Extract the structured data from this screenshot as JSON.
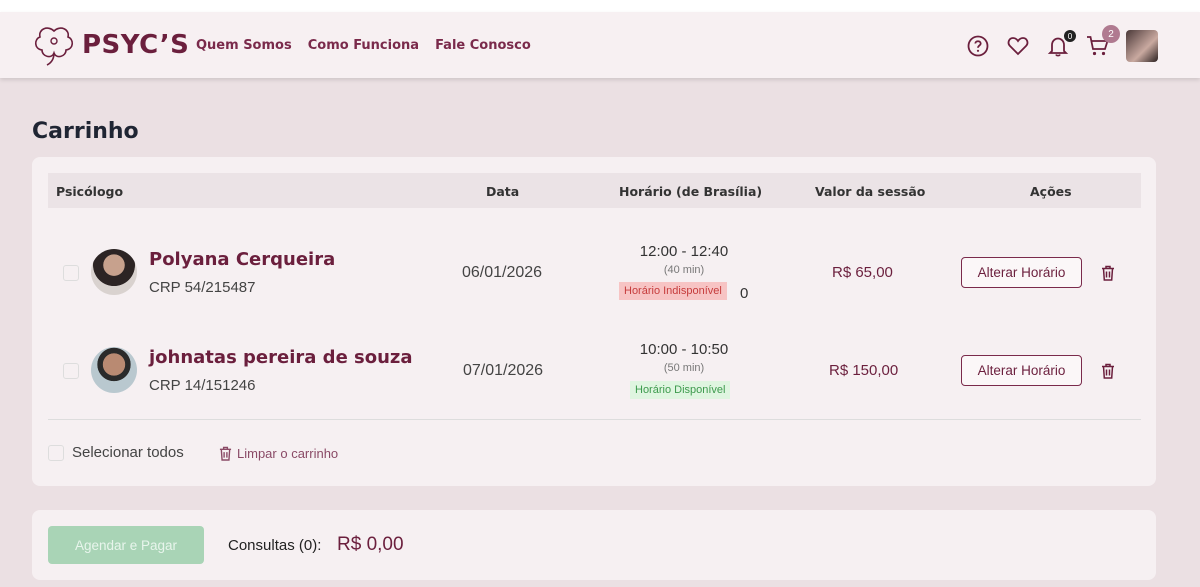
{
  "brand": {
    "name": "PSYC’S",
    "accent": "#6b1f3d"
  },
  "nav": [
    {
      "label": "Quem Somos"
    },
    {
      "label": "Como Funciona"
    },
    {
      "label": "Fale Conosco"
    }
  ],
  "header_icons": {
    "help": "help-circle-icon",
    "favorites": "heart-icon",
    "notifications": {
      "icon": "bell-icon",
      "count": "0"
    },
    "cart": {
      "icon": "cart-icon",
      "count": "2"
    }
  },
  "page": {
    "title": "Carrinho"
  },
  "table": {
    "headers": {
      "psychologist": "Psicólogo",
      "date": "Data",
      "time": "Horário (de Brasília)",
      "price": "Valor da sessão",
      "actions": "Ações"
    },
    "rows": [
      {
        "name": "Polyana Cerqueira",
        "crp": "CRP 54/215487",
        "date": "06/01/2026",
        "time": "12:00 - 12:40",
        "duration": "(40 min)",
        "status": "Horário Indisponível",
        "status_type": "unavailable",
        "extra": "0",
        "price": "R$ 65,00",
        "action": "Alterar Horário"
      },
      {
        "name": "johnatas pereira de souza",
        "crp": "CRP 14/151246",
        "date": "07/01/2026",
        "time": "10:00 - 10:50",
        "duration": "(50 min)",
        "status": "Horário Disponível",
        "status_type": "available",
        "price": "R$ 150,00",
        "action": "Alterar Horário"
      }
    ]
  },
  "select_all": "Selecionar todos",
  "clear_cart": "Limpar o carrinho",
  "footer": {
    "pay_button": "Agendar e Pagar",
    "consultations_label": "Consultas (0):",
    "total": "R$ 0,00"
  }
}
